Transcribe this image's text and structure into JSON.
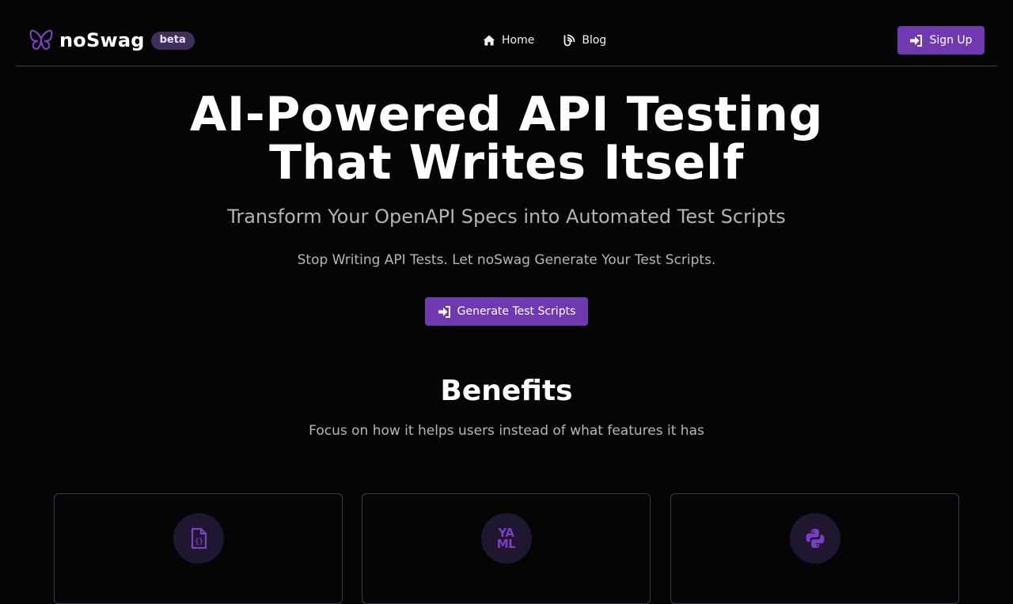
{
  "brand": {
    "name": "noSwag",
    "badge": "beta"
  },
  "nav": {
    "items": [
      {
        "label": "Home",
        "icon": "home-icon"
      },
      {
        "label": "Blog",
        "icon": "blog-icon"
      }
    ],
    "signup_label": "Sign Up"
  },
  "hero": {
    "title_line1": "AI-Powered API Testing",
    "title_line2": "That Writes Itself",
    "subtitle": "Transform Your OpenAPI Specs into Automated Test Scripts",
    "description": "Stop Writing API Tests. Let noSwag Generate Your Test Scripts.",
    "cta_label": "Generate Test Scripts"
  },
  "benefits": {
    "title": "Benefits",
    "subtitle": "Focus on how it helps users instead of what features it has",
    "cards": [
      {
        "icon": "file-code-icon"
      },
      {
        "icon": "yaml-icon",
        "icon_text_line1": "YA",
        "icon_text_line2": "ML"
      },
      {
        "icon": "python-icon"
      }
    ]
  },
  "colors": {
    "background": "#050505",
    "accent": "#7139b0",
    "icon_purple": "#7c3fc4",
    "badge_bg": "#3f2f5a",
    "muted_text": "#b4b4b4",
    "border": "#3f3c55"
  }
}
